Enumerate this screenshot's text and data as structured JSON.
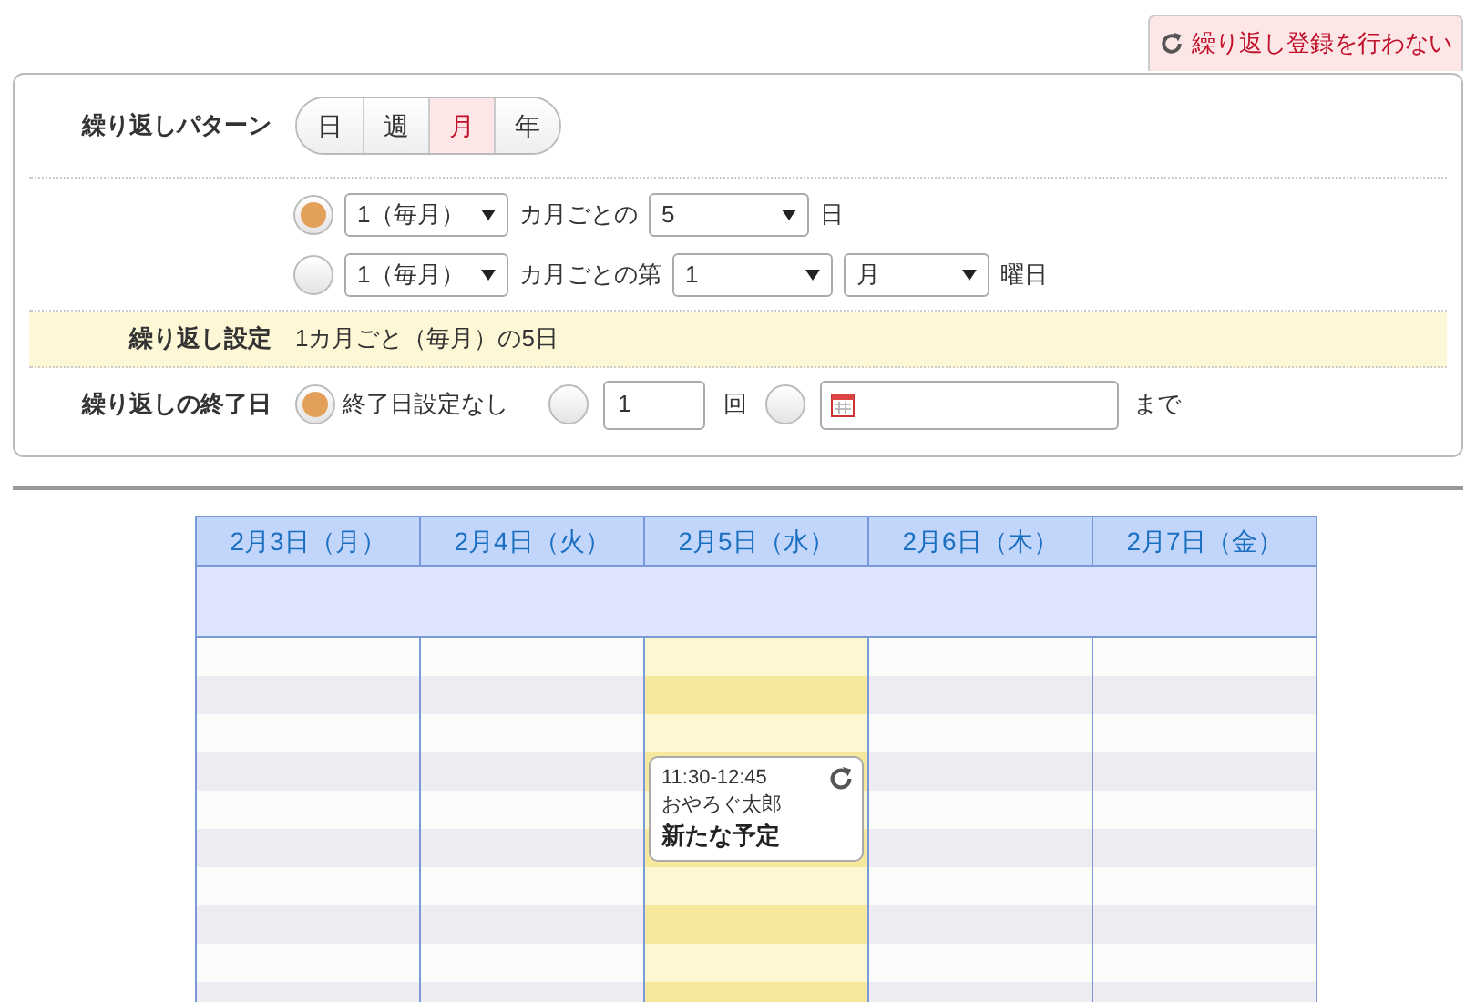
{
  "skip_button": {
    "label": "繰り返し登録を行わない"
  },
  "pattern": {
    "label": "繰り返しパターン",
    "options": [
      {
        "label": "日",
        "selected": false
      },
      {
        "label": "週",
        "selected": false
      },
      {
        "label": "月",
        "selected": true
      },
      {
        "label": "年",
        "selected": false
      }
    ]
  },
  "monthly_options": [
    {
      "selected": true,
      "parts": [
        {
          "kind": "select",
          "value": "1（毎月）"
        },
        {
          "kind": "text",
          "value": "カ月ごとの"
        },
        {
          "kind": "select",
          "value": "5"
        },
        {
          "kind": "text",
          "value": "日"
        }
      ]
    },
    {
      "selected": false,
      "parts": [
        {
          "kind": "select",
          "value": "1（毎月）"
        },
        {
          "kind": "text",
          "value": "カ月ごとの第"
        },
        {
          "kind": "select",
          "value": "1"
        },
        {
          "kind": "select",
          "value": "月"
        },
        {
          "kind": "text",
          "value": "曜日"
        }
      ]
    }
  ],
  "summary": {
    "label": "繰り返し設定",
    "value": "1カ月ごと（毎月）の5日"
  },
  "end": {
    "label": "繰り返しの終了日",
    "options": [
      {
        "kind": "none",
        "selected": true,
        "label": "終了日設定なし"
      },
      {
        "kind": "count",
        "selected": false,
        "value": "1",
        "unit": "回"
      },
      {
        "kind": "date",
        "selected": false,
        "unit": "まで"
      }
    ]
  },
  "calendar": {
    "days": [
      {
        "label": "2月3日（月）",
        "selected": false
      },
      {
        "label": "2月4日（火）",
        "selected": false
      },
      {
        "label": "2月5日（水）",
        "selected": true,
        "event": {
          "time": "11:30-12:45",
          "owner": "おやろぐ太郎",
          "title": "新たな予定",
          "repeating": true
        }
      },
      {
        "label": "2月6日（木）",
        "selected": false
      },
      {
        "label": "2月7日（金）",
        "selected": false
      }
    ]
  }
}
